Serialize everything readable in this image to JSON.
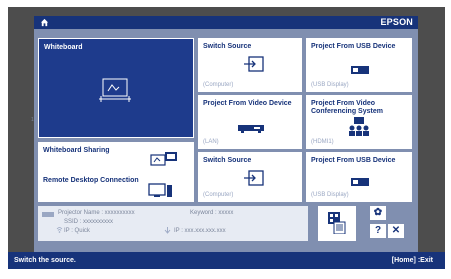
{
  "brand": "EPSON",
  "tiles": {
    "whiteboard": "Whiteboard",
    "whiteboard_sharing": "Whiteboard Sharing",
    "remote_desktop": "Remote Desktop Connection",
    "switch_source_1": {
      "title": "Switch Source",
      "sub": "(Computer)"
    },
    "project_usb_1": {
      "title": "Project From USB Device",
      "sub": "(USB Display)"
    },
    "project_video": {
      "title": "Project From Video Device",
      "sub": "(LAN)"
    },
    "project_vconf": {
      "title": "Project From Video Conferencing System",
      "sub": "(HDMI1)"
    },
    "switch_source_2": {
      "title": "Switch Source",
      "sub": "(Computer)"
    },
    "project_usb_2": {
      "title": "Project From USB Device",
      "sub": "(USB Display)"
    }
  },
  "info": {
    "projector_name": "Projector Name : xxxxxxxxxx",
    "keyword": "Keyword : xxxxx",
    "ssid": "SSID : xxxxxxxxxx",
    "ip_quick": "IP : Quick",
    "ip": "IP : xxx.xxx.xxx.xxx"
  },
  "side_buttons": {
    "settings": "✿",
    "help": "?",
    "close": "✕"
  },
  "status": {
    "hint": "Switch the source.",
    "exit": "[Home] :Exit"
  },
  "colors": {
    "navy": "#17337a",
    "panel": "#808fb0",
    "tile": "#ffffff",
    "active": "#1e3b8c"
  }
}
